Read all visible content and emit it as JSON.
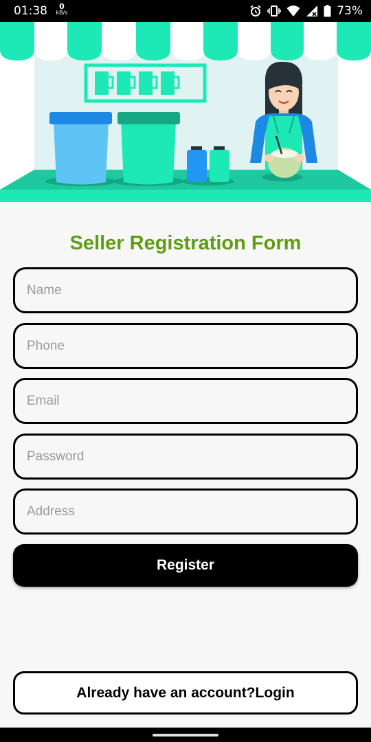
{
  "status_bar": {
    "time": "01:38",
    "net_speed_value": "0",
    "net_speed_unit": "kB/s",
    "battery": "73%",
    "icons": [
      "alarm-icon",
      "vibrate-icon",
      "wifi-icon",
      "signal-icon",
      "battery-icon"
    ]
  },
  "hero": {
    "illustration": "coconut-shop-seller-illustration"
  },
  "form": {
    "title": "Seller Registration Form",
    "fields": {
      "name": {
        "placeholder": "Name",
        "value": ""
      },
      "phone": {
        "placeholder": "Phone",
        "value": ""
      },
      "email": {
        "placeholder": "Email",
        "value": ""
      },
      "password": {
        "placeholder": "Password",
        "value": ""
      },
      "address": {
        "placeholder": "Address",
        "value": ""
      }
    },
    "register_label": "Register",
    "login_label": "Already have an account?Login"
  },
  "colors": {
    "title": "#5f9c14",
    "accent": "#1de9b6",
    "button_bg": "#000000",
    "background": "#f7f7f7"
  }
}
